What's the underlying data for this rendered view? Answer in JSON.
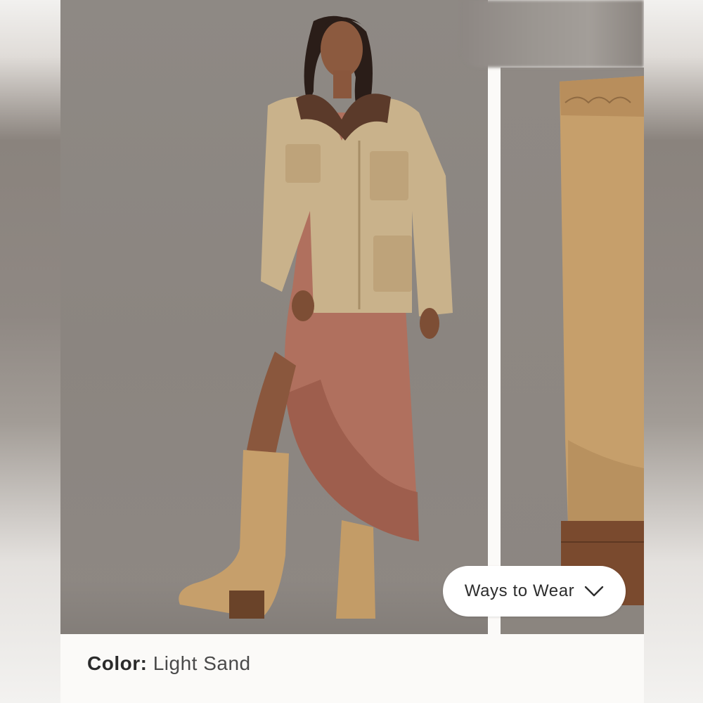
{
  "product": {
    "color_label": "Color:",
    "color_value": "Light Sand"
  },
  "carousel": {
    "ways_to_wear_label": "Ways to Wear",
    "ways_to_wear_icon": "chevron-down-icon"
  },
  "colors": {
    "backdrop": "#8e8984",
    "jacket": "#c7b08a",
    "dress": "#b0705e",
    "boot": "#c69f6b",
    "button_bg": "#ffffff",
    "text": "#2e2e2e"
  }
}
